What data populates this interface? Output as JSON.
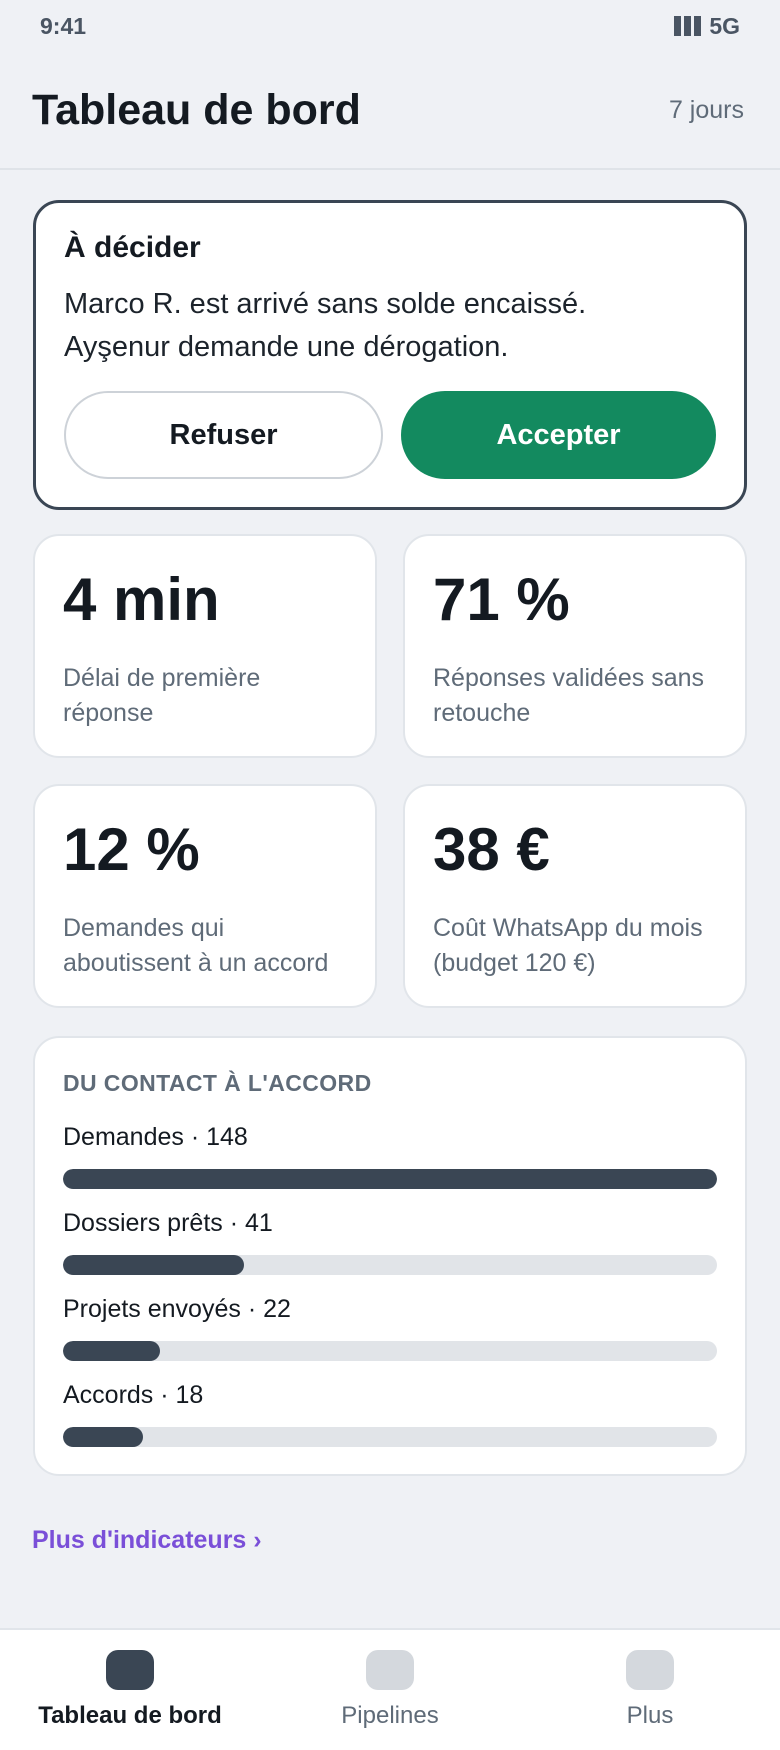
{
  "status": {
    "time": "9:41",
    "network": "5G",
    "signal_icon": "signal-bars-icon"
  },
  "header": {
    "title": "Tableau de bord",
    "period": "7 jours"
  },
  "decision": {
    "title": "À décider",
    "line1": "Marco R. est arrivé sans solde encaissé.",
    "line2": "Ayşenur demande une dérogation.",
    "refuse_label": "Refuser",
    "accept_label": "Accepter"
  },
  "kpis": [
    {
      "value": "4 min",
      "label": "Délai de première réponse"
    },
    {
      "value": "71 %",
      "label": "Réponses validées sans retouche"
    },
    {
      "value": "12 %",
      "label": "Demandes qui aboutissent à un accord"
    },
    {
      "value": "38 €",
      "label": "Coût WhatsApp du mois (budget 120 €)"
    }
  ],
  "funnel": {
    "title": "DU CONTACT À L'ACCORD",
    "max": 148,
    "steps": [
      {
        "label": "Demandes · 148",
        "count": 148
      },
      {
        "label": "Dossiers prêts · 41",
        "count": 41
      },
      {
        "label": "Projets envoyés · 22",
        "count": 22
      },
      {
        "label": "Accords · 18",
        "count": 18
      }
    ]
  },
  "more_link": "Plus d'indicateurs ›",
  "nav": [
    {
      "label": "Tableau de bord",
      "active": true
    },
    {
      "label": "Pipelines",
      "active": false
    },
    {
      "label": "Plus",
      "active": false
    }
  ],
  "colors": {
    "accent": "#138a5f",
    "link": "#7a4fd8",
    "bar": "#3a4654",
    "track": "#e1e4e8"
  }
}
